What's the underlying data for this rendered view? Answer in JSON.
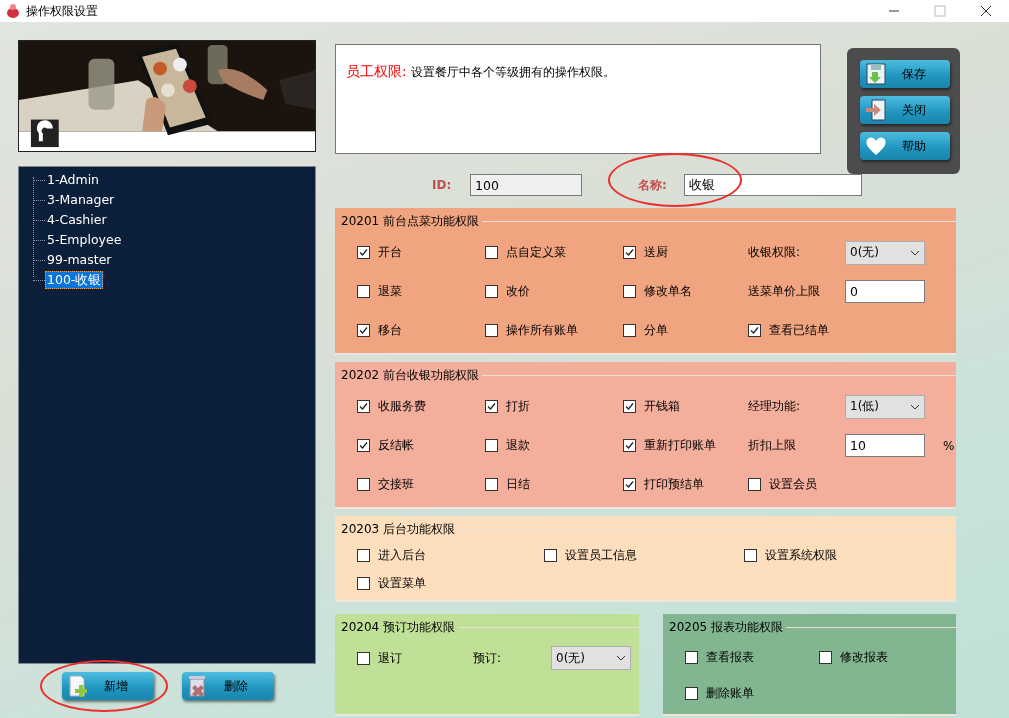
{
  "window": {
    "title": "操作权限设置"
  },
  "tree": {
    "items": [
      {
        "label": "1-Admin",
        "selected": false
      },
      {
        "label": "3-Manager",
        "selected": false
      },
      {
        "label": "4-Cashier",
        "selected": false
      },
      {
        "label": "5-Employee",
        "selected": false
      },
      {
        "label": "99-master",
        "selected": false
      },
      {
        "label": "100-收银",
        "selected": true
      }
    ]
  },
  "bottom_buttons": [
    {
      "label": "新增",
      "circled": true
    },
    {
      "label": "删除",
      "circled": false
    }
  ],
  "description": {
    "title": "员工权限:",
    "text": "设置餐厅中各个等级拥有的操作权限。"
  },
  "side_buttons": [
    {
      "label": "保存"
    },
    {
      "label": "关闭"
    },
    {
      "label": "帮助"
    }
  ],
  "id_field": {
    "label": "ID:",
    "value": "100"
  },
  "name_field": {
    "label": "名称:",
    "value": "收银",
    "circled": true
  },
  "groups": [
    {
      "title": "20201 前台点菜功能权限",
      "color": "#f0a47f",
      "cells": [
        {
          "kind": "checkbox",
          "label": "开台",
          "checked": true
        },
        {
          "kind": "checkbox",
          "label": "点自定义菜",
          "checked": false
        },
        {
          "kind": "checkbox",
          "label": "送厨",
          "checked": true
        },
        {
          "kind": "select",
          "label": "收银权限:",
          "value": "0(无)"
        },
        {
          "kind": "checkbox",
          "label": "退菜",
          "checked": false
        },
        {
          "kind": "checkbox",
          "label": "改价",
          "checked": false
        },
        {
          "kind": "checkbox",
          "label": "修改单名",
          "checked": false
        },
        {
          "kind": "input",
          "label": "送菜单价上限",
          "value": "0"
        },
        {
          "kind": "checkbox",
          "label": "移台",
          "checked": true
        },
        {
          "kind": "checkbox",
          "label": "操作所有账单",
          "checked": false
        },
        {
          "kind": "checkbox",
          "label": "分单",
          "checked": false
        },
        {
          "kind": "checkbox",
          "label": "查看已结单",
          "checked": true
        }
      ]
    },
    {
      "title": "20202 前台收银功能权限",
      "color": "#f4ae9c",
      "cells": [
        {
          "kind": "checkbox",
          "label": "收服务费",
          "checked": true
        },
        {
          "kind": "checkbox",
          "label": "打折",
          "checked": true
        },
        {
          "kind": "checkbox",
          "label": "开钱箱",
          "checked": true
        },
        {
          "kind": "select",
          "label": "经理功能:",
          "value": "1(低)"
        },
        {
          "kind": "checkbox",
          "label": "反结帐",
          "checked": true
        },
        {
          "kind": "checkbox",
          "label": "退款",
          "checked": false
        },
        {
          "kind": "checkbox",
          "label": "重新打印账单",
          "checked": true
        },
        {
          "kind": "input",
          "label": "折扣上限",
          "value": "10",
          "suffix": "%"
        },
        {
          "kind": "checkbox",
          "label": "交接班",
          "checked": false
        },
        {
          "kind": "checkbox",
          "label": "日结",
          "checked": false
        },
        {
          "kind": "checkbox",
          "label": "打印预结单",
          "checked": true
        },
        {
          "kind": "checkbox",
          "label": "设置会员",
          "checked": false
        }
      ]
    },
    {
      "title": "20203 后台功能权限",
      "color": "#fddebd",
      "cells": [
        {
          "kind": "checkbox",
          "label": "进入后台",
          "checked": false
        },
        {
          "kind": "checkbox",
          "label": "设置员工信息",
          "checked": false
        },
        {
          "kind": "checkbox",
          "label": "设置系统权限",
          "checked": false
        },
        {
          "kind": "checkbox",
          "label": "设置菜单",
          "checked": false
        }
      ]
    },
    {
      "title": "20204 预订功能权限",
      "color": "#c0e098",
      "cells": [
        {
          "kind": "checkbox",
          "label": "退订",
          "checked": false
        },
        {
          "kind": "select",
          "label": "预订:",
          "value": "0(无)"
        }
      ]
    },
    {
      "title": "20205 报表功能权限",
      "color": "#82b690",
      "cells": [
        {
          "kind": "checkbox",
          "label": "查看报表",
          "checked": false
        },
        {
          "kind": "checkbox",
          "label": "修改报表",
          "checked": false
        },
        {
          "kind": "checkbox",
          "label": "删除账单",
          "checked": false
        }
      ]
    }
  ]
}
